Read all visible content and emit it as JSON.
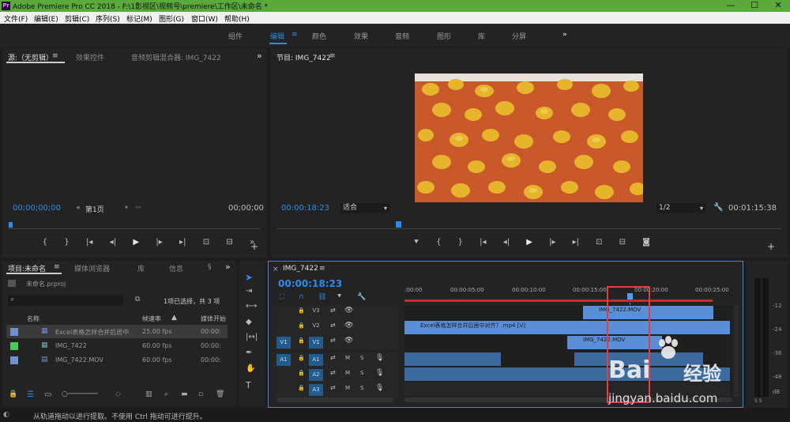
{
  "window": {
    "title": "Adobe Premiere Pro CC 2018 - F:\\1影视区\\视频号\\premiere\\工作区\\未命名 *",
    "app_icon": "Pr",
    "minimize": "—",
    "maximize": "☐",
    "close": "✕"
  },
  "menu": [
    "文件(F)",
    "编辑(E)",
    "剪辑(C)",
    "序列(S)",
    "标记(M)",
    "图形(G)",
    "窗口(W)",
    "帮助(H)"
  ],
  "workspaces": [
    {
      "label": "组件",
      "active": false
    },
    {
      "label": "编辑",
      "active": true
    },
    {
      "label": "颜色",
      "active": false
    },
    {
      "label": "效果",
      "active": false
    },
    {
      "label": "音频",
      "active": false
    },
    {
      "label": "图形",
      "active": false
    },
    {
      "label": "库",
      "active": false
    },
    {
      "label": "分屏",
      "active": false
    }
  ],
  "workspace_more": "»",
  "source_panel": {
    "tabs": [
      "源:（无剪辑）",
      "效果控件",
      "音频剪辑混合器: IMG_7422"
    ],
    "timecode_left": "00;00;00;00",
    "page_select": "第1页",
    "timecode_right": "00;00;00"
  },
  "program_panel": {
    "title": "节目: IMG_7422",
    "timecode": "00:00:18:23",
    "fit_select": "适合",
    "resolution_select": "1/2",
    "duration": "00:01:15:38"
  },
  "project_panel": {
    "tabs": [
      "项目:未命名",
      "媒体浏览器",
      "库",
      "信息",
      "§"
    ],
    "project_file": "未命名.prproj",
    "selection_info": "1项已选择，共 3 项",
    "columns": [
      "名称",
      "帧速率",
      "媒体开始"
    ],
    "items": [
      {
        "name": "Excel表格怎样合并后居中",
        "fps": "25.00 fps",
        "start": "00:00:",
        "color": "#6f8fd0",
        "type": "sequence",
        "selected": true
      },
      {
        "name": "IMG_7422",
        "fps": "60.00 fps",
        "start": "00:00:",
        "color": "#49c95a",
        "type": "sequence",
        "selected": false
      },
      {
        "name": "IMG_7422.MOV",
        "fps": "60.00 fps",
        "start": "00:00:",
        "color": "#6f8fd0",
        "type": "clip",
        "selected": false
      }
    ]
  },
  "timeline": {
    "sequence_name": "IMG_7422",
    "timecode": "00:00:18:23",
    "ruler": [
      ":00:00",
      "00:00:05:00",
      "00:00:10:00",
      "00:00:15:00",
      "00:00:20:00",
      "00:00:25:00"
    ],
    "video_tracks": [
      {
        "src": "",
        "label": "V3"
      },
      {
        "src": "",
        "label": "V2"
      },
      {
        "src": "V1",
        "label": "V1"
      }
    ],
    "audio_tracks": [
      {
        "src": "A1",
        "label": "A1"
      },
      {
        "src": "",
        "label": "A2"
      },
      {
        "src": "",
        "label": "A3"
      }
    ],
    "clips": {
      "v3": "IMG_7422.MOV",
      "v2": "Excel表格怎样合并后居中对齐？.mp4 [V]",
      "v1": "IMG_7422.MOV"
    },
    "mute": "M",
    "solo": "S"
  },
  "meter_scale": [
    "-12",
    "-24",
    "-36",
    "-48",
    "dB"
  ],
  "meter_solo": "S S",
  "status_bar": "从轨道拖动以进行提取。不使用 Ctrl 拖动可进行提升。",
  "watermark": {
    "logo": "Bai",
    "logo_cn": "经验",
    "url": "jingyan.baidu.com"
  },
  "colors": {
    "accent": "#2d8ceb",
    "clip": "#5a8ed6",
    "playhead": "#4a9dff",
    "titlebar": "#5aa93a",
    "highlight_box": "#e04040"
  }
}
